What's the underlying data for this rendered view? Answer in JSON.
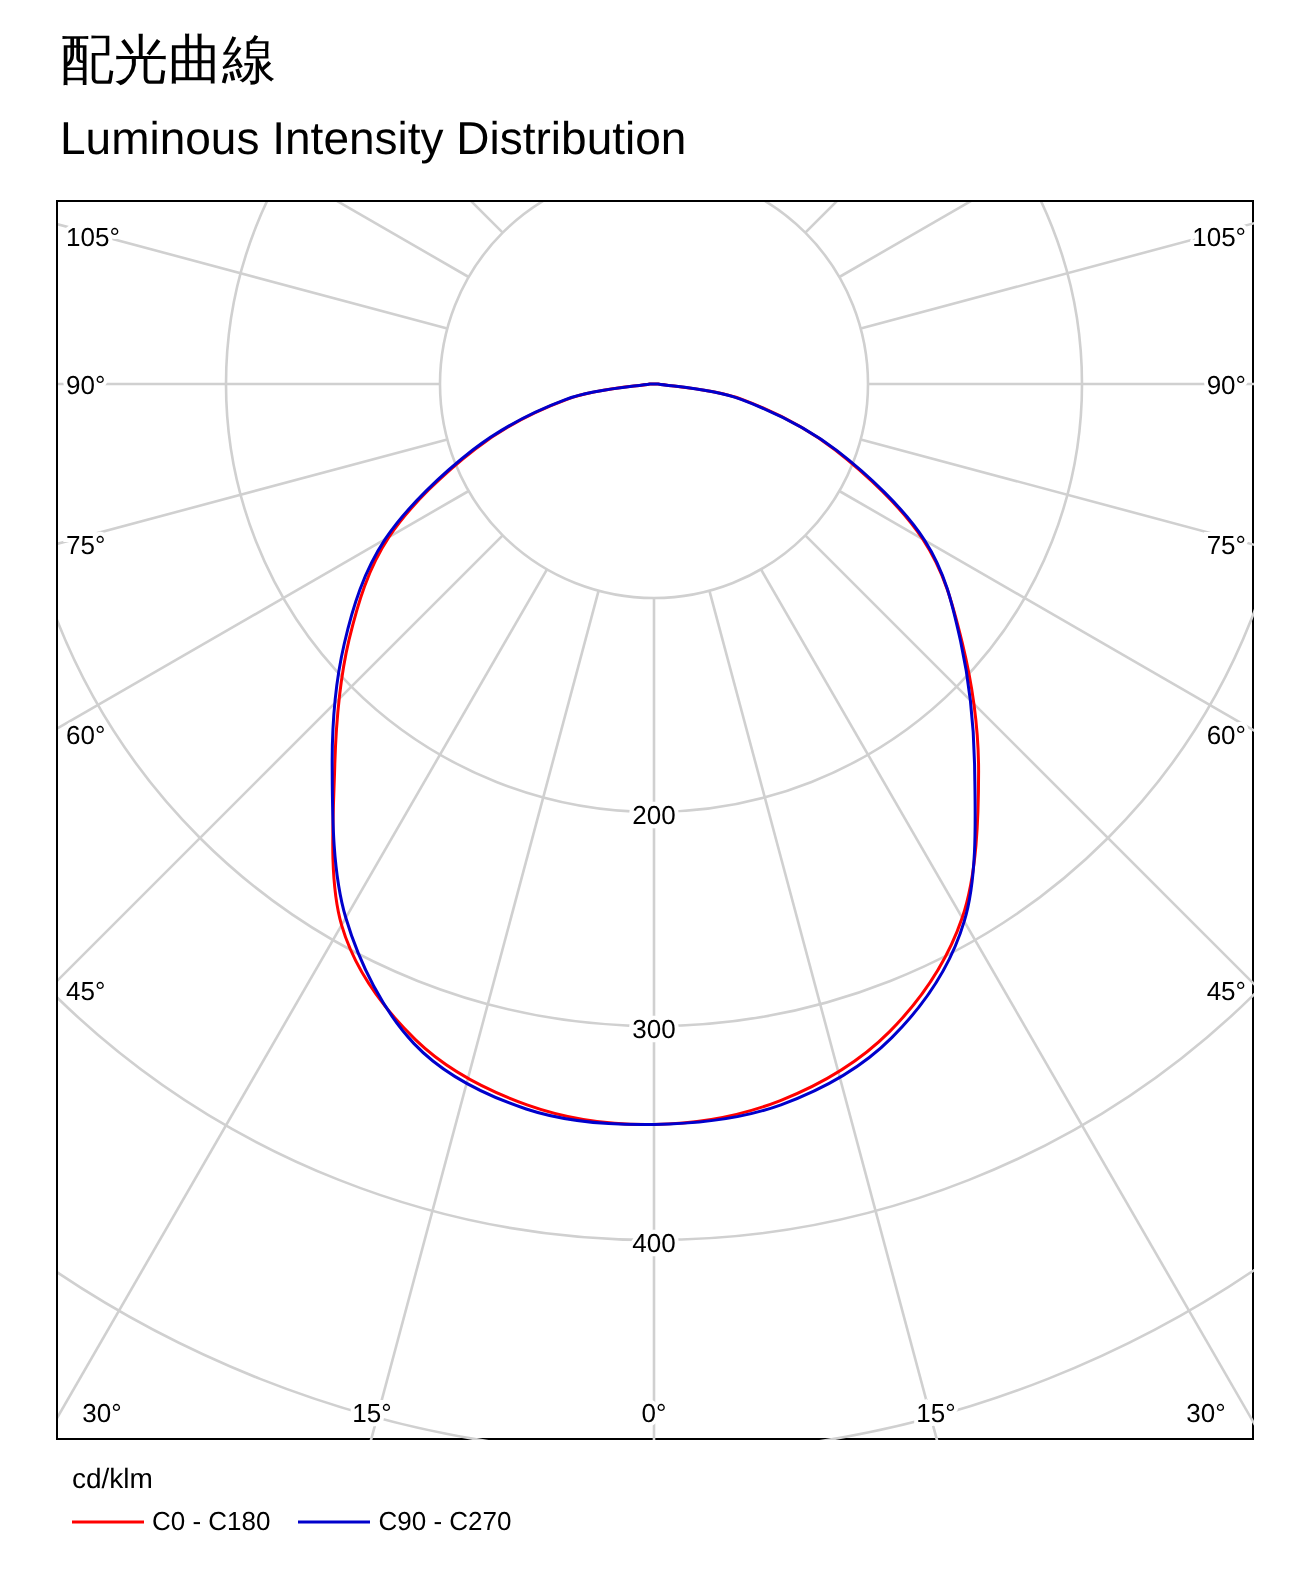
{
  "title": "配光曲線",
  "subtitle": "Luminous Intensity Distribution",
  "polar_plot": {
    "left_angle_labels": [
      "105°",
      "90°",
      "75°",
      "60°",
      "45°"
    ],
    "bottom_angle_labels": [
      "30°",
      "15°",
      "0°",
      "15°",
      "30°"
    ],
    "right_angle_labels": [
      "105°",
      "90°",
      "75°",
      "60°",
      "45°"
    ],
    "ring_labels": [
      "200",
      "300",
      "400"
    ],
    "unit": "cd/klm",
    "legend": [
      {
        "name": "C0 - C180",
        "color": "#ff0000"
      },
      {
        "name": "C90 - C270",
        "color": "#0000cc"
      }
    ]
  }
}
